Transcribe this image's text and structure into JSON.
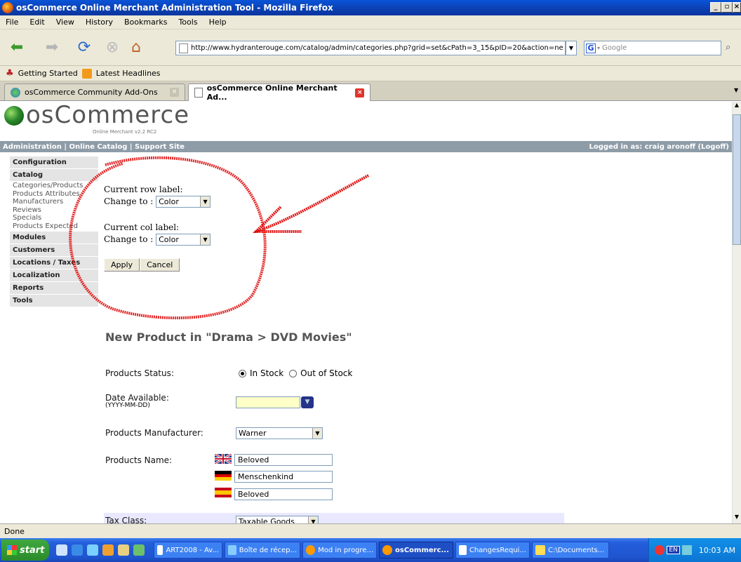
{
  "window": {
    "title": "osCommerce Online Merchant Administration Tool - Mozilla Firefox"
  },
  "menubar": [
    "File",
    "Edit",
    "View",
    "History",
    "Bookmarks",
    "Tools",
    "Help"
  ],
  "nav": {
    "url": "http://www.hydranterouge.com/catalog/admin/categories.php?grid=set&cPath=3_15&pID=20&action=ne",
    "search_placeholder": "Google"
  },
  "bookmarks": [
    "Getting Started",
    "Latest Headlines"
  ],
  "tabs": [
    {
      "label": "osCommerce Community Add-Ons"
    },
    {
      "label": "osCommerce Online Merchant Ad..."
    }
  ],
  "site": {
    "logo": "osCommerce",
    "logo_sub": "Online Merchant v2.2 RC2",
    "adminbar_left": "Administration  |  Online Catalog  |  Support Site",
    "adminbar_right": "Logged in as: craig aronoff (Logoff)"
  },
  "leftmenu": {
    "configuration": "Configuration",
    "catalog": "Catalog",
    "catalog_items": [
      "Categories/Products",
      "Products Attributes",
      "Manufacturers",
      "Reviews",
      "Specials",
      "Products Expected"
    ],
    "modules": "Modules",
    "customers": "Customers",
    "locations": "Locations / Taxes",
    "localization": "Localization",
    "reports": "Reports",
    "tools": "Tools"
  },
  "grid": {
    "row_label": "Current row label:",
    "col_label": "Current col label:",
    "change_to": "Change to :",
    "row_value": "Color",
    "col_value": "Color",
    "apply": "Apply",
    "cancel": "Cancel"
  },
  "form": {
    "heading": "New Product in \"Drama > DVD Movies\"",
    "status_label": "Products Status:",
    "in_stock": "In Stock",
    "out_of_stock": "Out of Stock",
    "date_label": "Date Available:",
    "date_hint": "(YYYY-MM-DD)",
    "date_value": "",
    "manufacturer_label": "Products Manufacturer:",
    "manufacturer_value": "Warner",
    "name_label": "Products Name:",
    "name_en": "Beloved",
    "name_de": "Menschenkind",
    "name_es": "Beloved",
    "tax_label": "Tax Class:",
    "tax_value": "Taxable Goods"
  },
  "status": "Done",
  "taskbar": {
    "start": "start",
    "tasks": [
      "ART2008 - Av...",
      "Boîte de récep...",
      "Mod in progre...",
      "osCommerc...",
      "ChangesRequi...",
      "C:\\Documents..."
    ],
    "lang": "EN",
    "clock": "10:03 AM"
  }
}
